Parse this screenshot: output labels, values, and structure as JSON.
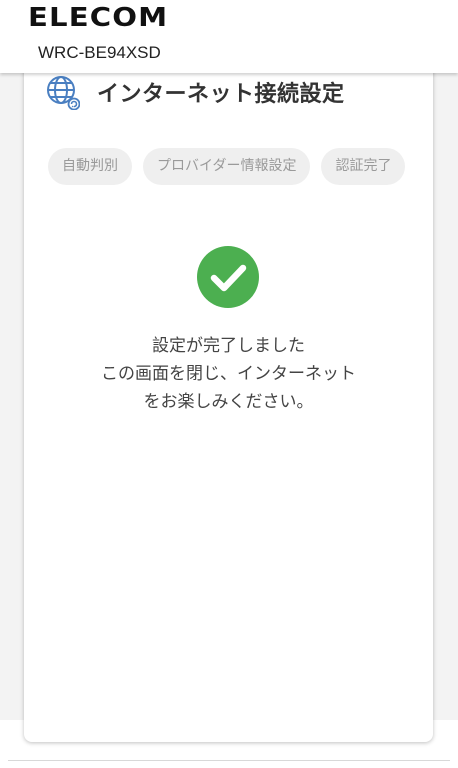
{
  "header": {
    "brand": "ELECOM",
    "model": "WRC-BE94XSD"
  },
  "card": {
    "title": "インターネット接続設定",
    "title_icon": "globe-icon",
    "steps": [
      {
        "label": "自動判別"
      },
      {
        "label": "プロバイダー情報設定"
      },
      {
        "label": "認証完了"
      }
    ],
    "status_icon": "check-circle-icon",
    "message_lines": [
      "設定が完了しました",
      "この画面を閉じ、インターネット",
      "をお楽しみください。"
    ]
  },
  "colors": {
    "success_green": "#4caf50",
    "icon_blue": "#4a7fc1",
    "step_bg": "#efefef",
    "step_text": "#9a9a9a"
  }
}
